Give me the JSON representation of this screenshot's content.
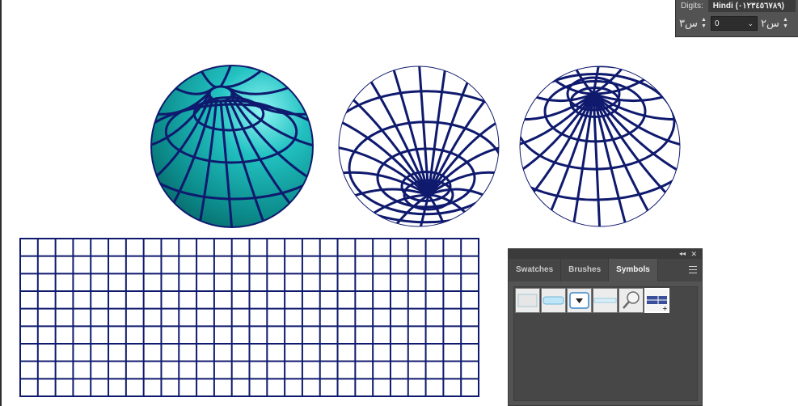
{
  "digits_panel": {
    "label": "Digits:",
    "value": "Hindi (٠١٢٣٤٥٦٧٨٩)",
    "left_icon": "س٣",
    "right_icon": "س٢",
    "number_value": "0"
  },
  "symbols_panel": {
    "tabs": [
      {
        "label": "Swatches"
      },
      {
        "label": "Brushes"
      },
      {
        "label": "Symbols"
      }
    ],
    "collapse_glyph": "◂◂",
    "close_glyph": "✕",
    "symbols": [
      {
        "icon": "blank-square-symbol"
      },
      {
        "icon": "light-blue-bar-symbol"
      },
      {
        "icon": "dropdown-button-symbol"
      },
      {
        "icon": "thin-bar-symbol"
      },
      {
        "icon": "magnifier-symbol"
      },
      {
        "icon": "navy-flag-symbol"
      }
    ]
  },
  "artwork": {
    "line_color": "#0f1a6e",
    "globe_fill": "#17b0b0",
    "globe_highlight": "#7ff0f0",
    "grid_rows": 9,
    "grid_cols": 26
  }
}
